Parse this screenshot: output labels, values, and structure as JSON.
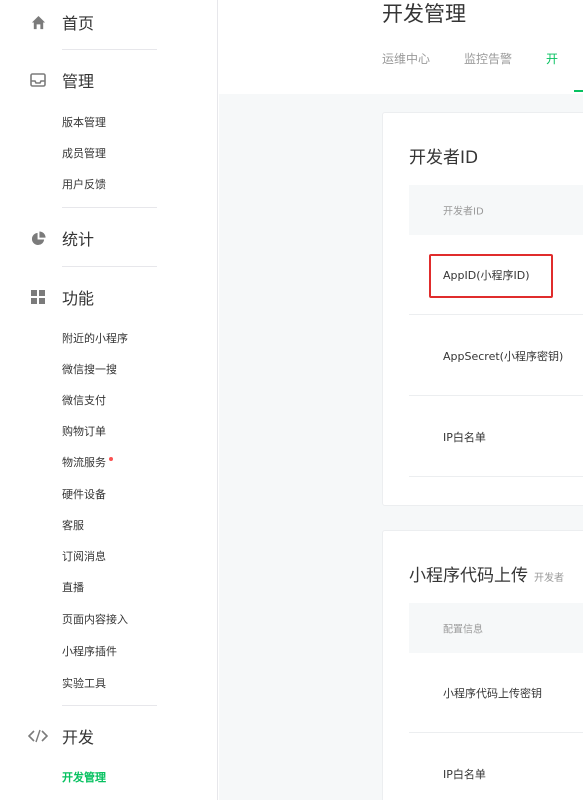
{
  "sidebar": {
    "home": {
      "label": "首页",
      "icon": "home-icon"
    },
    "manage": {
      "label": "管理",
      "icon": "inbox-icon",
      "items": [
        "版本管理",
        "成员管理",
        "用户反馈"
      ]
    },
    "stats": {
      "label": "统计",
      "icon": "pie-chart-icon"
    },
    "features": {
      "label": "功能",
      "icon": "grid-icon",
      "items": [
        "附近的小程序",
        "微信搜一搜",
        "微信支付",
        "购物订单",
        "物流服务",
        "硬件设备",
        "客服",
        "订阅消息",
        "直播",
        "页面内容接入",
        "小程序插件",
        "实验工具"
      ]
    },
    "dev": {
      "label": "开发",
      "icon": "code-icon",
      "items": [
        "开发管理"
      ]
    }
  },
  "main": {
    "title": "开发管理",
    "tabs": [
      "运维中心",
      "监控告警",
      "开"
    ],
    "developer_card": {
      "title": "开发者ID",
      "header": "开发者ID",
      "rows": [
        "AppID(小程序ID)",
        "AppSecret(小程序密钥)",
        "IP白名单"
      ]
    },
    "upload_card": {
      "title": "小程序代码上传",
      "subtitle": "开发者",
      "header": "配置信息",
      "rows": [
        "小程序代码上传密钥",
        "IP白名单"
      ]
    }
  },
  "colors": {
    "accent": "#07c160",
    "highlight": "#e02c2c",
    "dot": "#fa5151"
  }
}
